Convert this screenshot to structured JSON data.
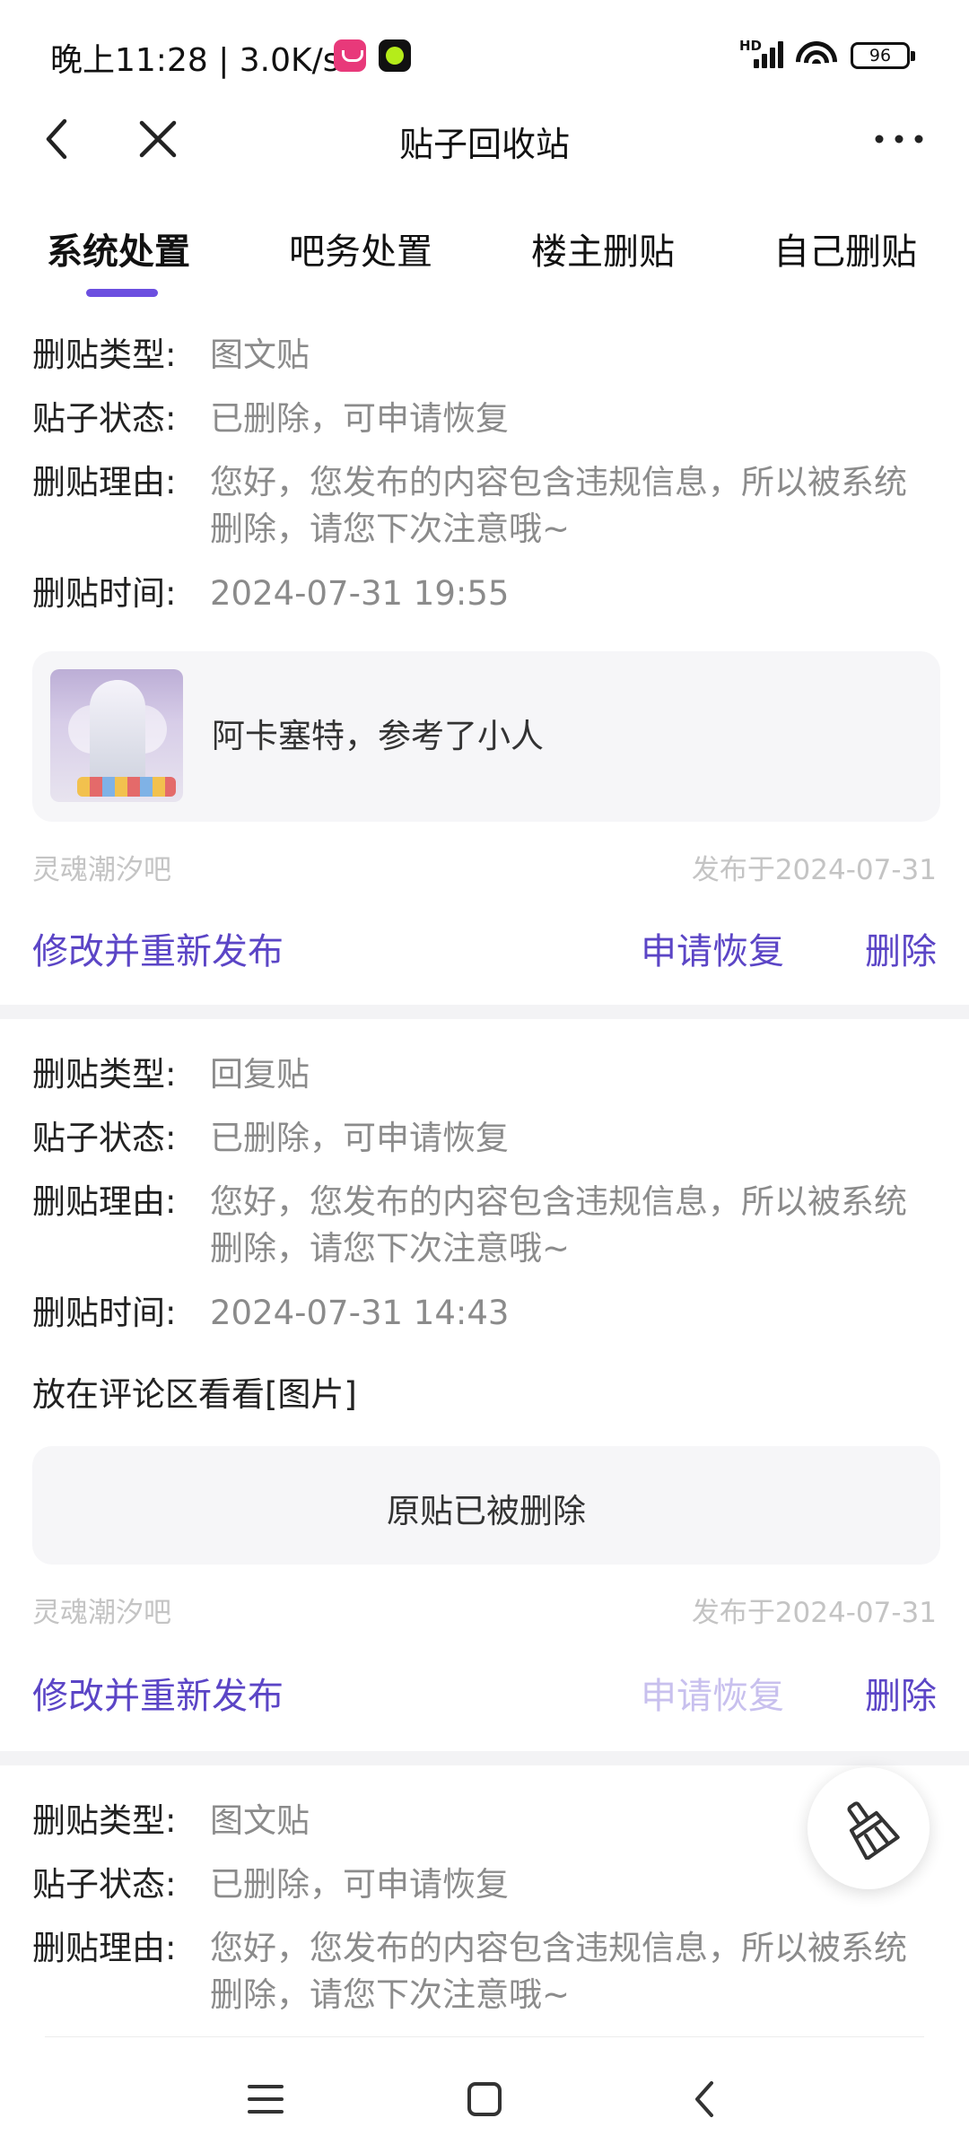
{
  "status_bar": {
    "time_speed": "晚上11:28 | 3.0K/s",
    "network_badge": "HD",
    "battery": "96"
  },
  "header": {
    "title": "贴子回收站"
  },
  "tabs": [
    {
      "label": "系统处置",
      "active": true
    },
    {
      "label": "吧务处置",
      "active": false
    },
    {
      "label": "楼主删贴",
      "active": false
    },
    {
      "label": "自己删贴",
      "active": false
    }
  ],
  "labels": {
    "type": "删贴类型:",
    "status": "贴子状态:",
    "reason": "删贴理由:",
    "time": "删贴时间:"
  },
  "posts": [
    {
      "type": "图文贴",
      "status": "已删除，可申请恢复",
      "reason": "您好，您发布的内容包含违规信息，所以被系统删除，请您下次注意哦~",
      "time": "2024-07-31 19:55",
      "quote": "阿卡塞特，参考了小人",
      "forum": "灵魂潮汐吧",
      "published": "发布于2024-07-31",
      "actions": {
        "edit": "修改并重新发布",
        "restore": "申请恢复",
        "delete": "删除"
      },
      "restore_enabled": true
    },
    {
      "type": "回复贴",
      "status": "已删除，可申请恢复",
      "reason": "您好，您发布的内容包含违规信息，所以被系统删除，请您下次注意哦~",
      "time": "2024-07-31 14:43",
      "content": "放在评论区看看[图片]",
      "quote": "原贴已被删除",
      "forum": "灵魂潮汐吧",
      "published": "发布于2024-07-31",
      "actions": {
        "edit": "修改并重新发布",
        "restore": "申请恢复",
        "delete": "删除"
      },
      "restore_enabled": false
    },
    {
      "type": "图文贴",
      "status": "已删除，可申请恢复",
      "reason": "您好，您发布的内容包含违规信息，所以被系统删除，请您下次注意哦~"
    }
  ],
  "colors": {
    "accent": "#5b45c6",
    "accent_disabled": "#c8c0ee",
    "tab_indicator": "#6c4fe0",
    "muted_text": "#8b8b8b"
  },
  "icons": {
    "back": "chevron-left-icon",
    "close": "close-icon",
    "more": "more-dots-icon",
    "fab": "broom-icon"
  }
}
